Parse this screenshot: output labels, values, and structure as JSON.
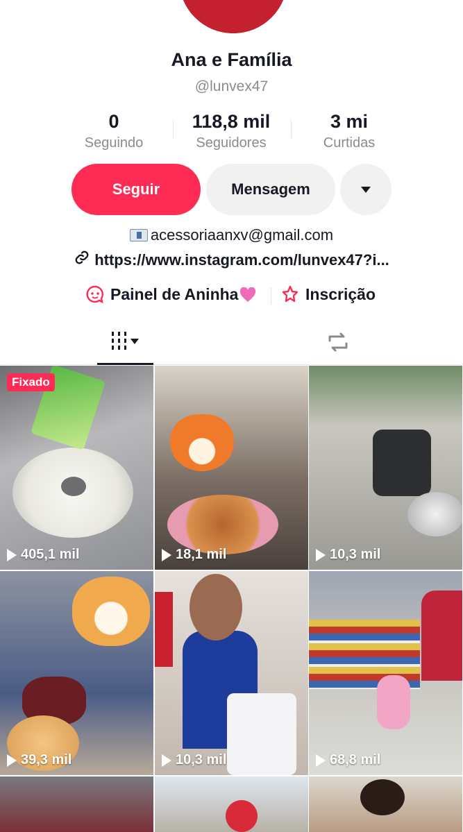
{
  "profile": {
    "name": "Ana e Família",
    "handle": "@lunvex47"
  },
  "stats": [
    {
      "value": "0",
      "label": "Seguindo"
    },
    {
      "value": "118,8 mil",
      "label": "Seguidores"
    },
    {
      "value": "3 mi",
      "label": "Curtidas"
    }
  ],
  "actions": {
    "follow": "Seguir",
    "message": "Mensagem"
  },
  "bio": {
    "email": "acessoriaanxv@gmail.com",
    "link": "https://www.instagram.com/lunvex47?i..."
  },
  "panels": [
    {
      "label": "Painel de Aninha"
    },
    {
      "label": "Inscrição"
    }
  ],
  "videos": [
    {
      "views": "405,1 mil",
      "pinned": "Fixado"
    },
    {
      "views": "18,1 mil"
    },
    {
      "views": "10,3 mil"
    },
    {
      "views": "39,3 mil"
    },
    {
      "views": "10,3 mil"
    },
    {
      "views": "68,8 mil"
    },
    {
      "views": ""
    },
    {
      "views": ""
    },
    {
      "views": ""
    }
  ],
  "colors": {
    "accent": "#fe2c55",
    "text": "#161823",
    "muted": "#8a8b91",
    "button_bg": "#f1f1f2"
  },
  "icons": {
    "email": "envelope-icon",
    "link": "link-icon",
    "panel": "chat-icon",
    "subscription": "star-icon",
    "videos_tab": "grid-icon",
    "reposts_tab": "repost-icon"
  }
}
